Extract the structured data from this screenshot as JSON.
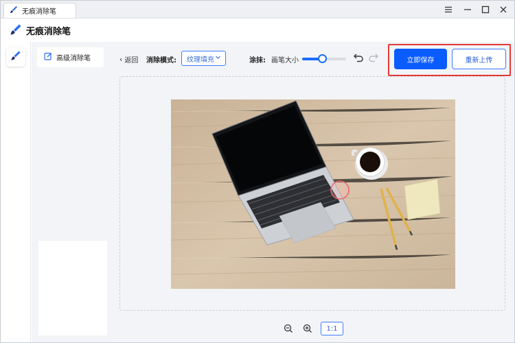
{
  "window": {
    "tab_title": "无痕消除笔",
    "controls": {
      "menu": "menu-icon",
      "minimize": "minimize-icon",
      "maximize": "maximize-icon",
      "close": "close-icon"
    }
  },
  "header": {
    "app_title": "无痕消除笔",
    "icon": "brush-icon"
  },
  "rail": {
    "items": [
      {
        "icon": "brush-icon",
        "selected": true
      }
    ]
  },
  "side_panel": {
    "items": [
      {
        "label": "高级消除笔",
        "icon": "edit-icon",
        "selected": true
      }
    ]
  },
  "toolbar": {
    "back_label": "返回",
    "mode_label": "消除模式:",
    "mode_value": "纹理填充",
    "erase_label": "涂抹:",
    "brush_size_label": "画笔大小",
    "brush_size_fraction": 0.45,
    "save_label": "立即保存",
    "reupload_label": "重新上传"
  },
  "canvas": {
    "image_subject": "laptop, coffee cup, pencils and sticky note on wooden desk"
  },
  "zoom": {
    "level": "1:1",
    "zoom_out_icon": "zoom-out-icon",
    "zoom_in_icon": "zoom-in-icon"
  },
  "colors": {
    "accent": "#0b5cff",
    "highlight_border": "#e53935",
    "panel_bg": "#f2f4f7"
  }
}
